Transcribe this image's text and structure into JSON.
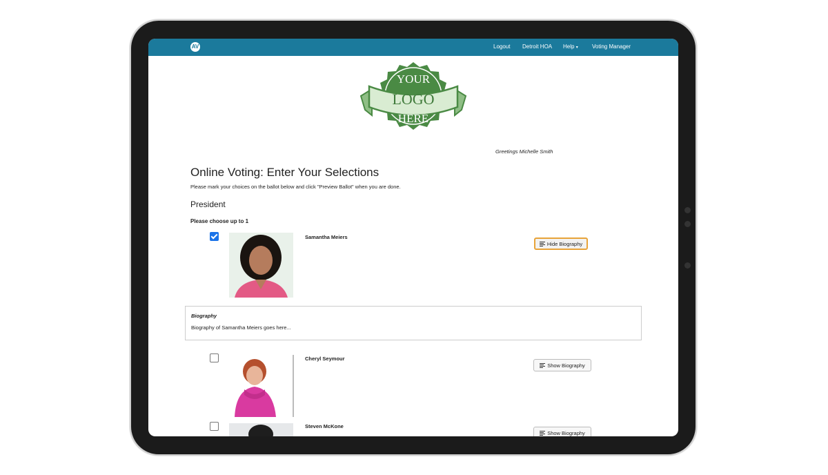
{
  "navbar": {
    "brand_mark": "AV",
    "logout": "Logout",
    "org": "Detroit HOA",
    "help": "Help",
    "help_caret": "▾",
    "voting_manager": "Voting Manager"
  },
  "logo": {
    "line1": "YOUR",
    "line2": "LOGO",
    "line3": "HERE",
    "color": "#4a8a44"
  },
  "greeting": "Greetings Michelle Smith",
  "page": {
    "title": "Online Voting: Enter Your Selections",
    "instructions": "Please mark your choices on the ballot below and click \"Preview Ballot\" when you are done.",
    "race_title": "President",
    "choose_label": "Please choose up to 1"
  },
  "candidates": [
    {
      "name": "Samantha Meiers",
      "checked": true,
      "button": "Hide Biography"
    },
    {
      "name": "Cheryl Seymour",
      "checked": false,
      "button": "Show Biography"
    },
    {
      "name": "Steven McKone",
      "checked": false,
      "button": "Show Biography"
    }
  ],
  "biography": {
    "heading": "Biography",
    "text": "Biography of Samantha Meiers goes here..."
  },
  "colors": {
    "navbar": "#1b7a9c",
    "checkbox_checked": "#1a73e8",
    "active_button_border": "#e8a339"
  }
}
